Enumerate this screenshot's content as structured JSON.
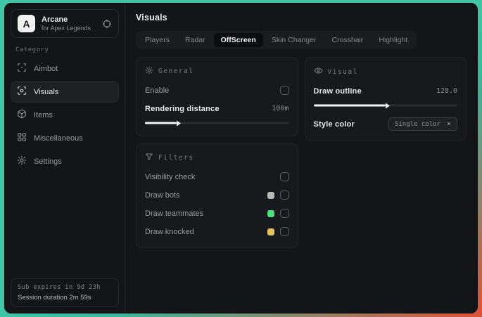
{
  "app": {
    "logo_letter": "A",
    "name": "Arcane",
    "subtitle": "for Apex Legends"
  },
  "sidebar": {
    "category_label": "Category",
    "items": [
      {
        "label": "Aimbot",
        "icon": "crosshair-scan-icon",
        "selected": false
      },
      {
        "label": "Visuals",
        "icon": "eye-scan-icon",
        "selected": true
      },
      {
        "label": "Items",
        "icon": "package-icon",
        "selected": false
      },
      {
        "label": "Miscellaneous",
        "icon": "layout-grid-icon",
        "selected": false
      },
      {
        "label": "Settings",
        "icon": "gear-icon",
        "selected": false
      }
    ],
    "footer": {
      "sub_expires": "Sub expires in 9d 23h",
      "session_duration": "Session duration 2m 59s"
    }
  },
  "main": {
    "title": "Visuals",
    "tabs": [
      {
        "label": "Players",
        "selected": false
      },
      {
        "label": "Radar",
        "selected": false
      },
      {
        "label": "OffScreen",
        "selected": true
      },
      {
        "label": "Skin Changer",
        "selected": false
      },
      {
        "label": "Crosshair",
        "selected": false
      },
      {
        "label": "Highlight",
        "selected": false
      }
    ],
    "general": {
      "title": "General",
      "enable_label": "Enable",
      "enable_checked": false,
      "rendering_label": "Rendering distance",
      "rendering_value": "100m",
      "rendering_percent": "22%"
    },
    "visual": {
      "title": "Visual",
      "outline_label": "Draw outline",
      "outline_value": "128.0",
      "outline_percent": "50%",
      "style_label": "Style color",
      "style_value": "Single color",
      "style_clear": "×"
    },
    "filters": {
      "title": "Filters",
      "rows": [
        {
          "label": "Visibility check",
          "checked": false
        },
        {
          "label": "Draw bots",
          "swatch": "#b8b8b8",
          "checked": false
        },
        {
          "label": "Draw teammates",
          "swatch": "#4ade80",
          "checked": false
        },
        {
          "label": "Draw knocked",
          "swatch": "#e3c35b",
          "checked": false
        }
      ]
    }
  },
  "colors": {
    "desktop_teal": "#41c7a7",
    "desktop_red": "#dd5236",
    "window_bg": "#141519",
    "panel_bg": "#17191c",
    "selected_tab_bg": "#0b0c0e"
  }
}
